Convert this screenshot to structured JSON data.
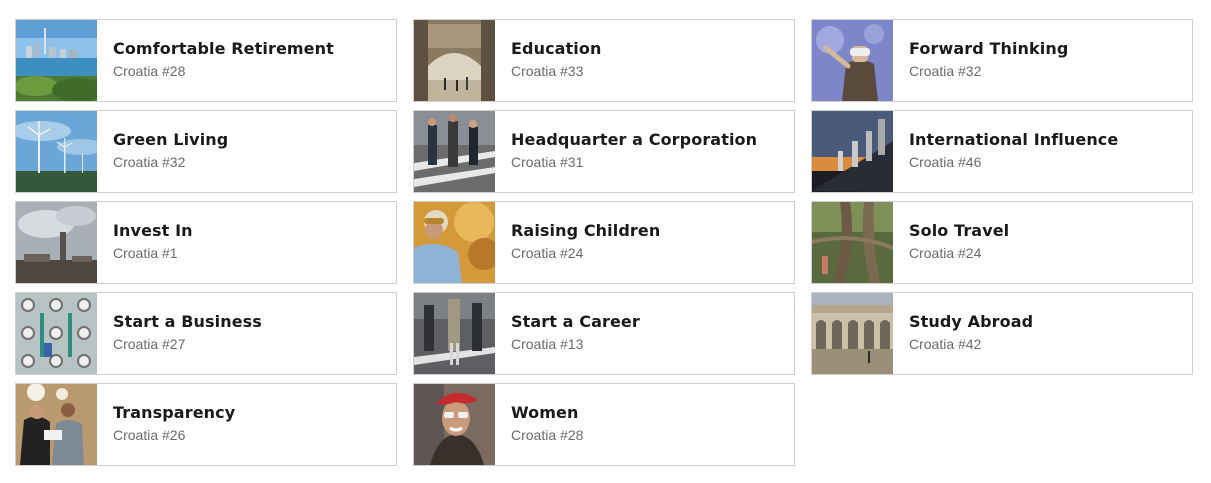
{
  "cards": [
    {
      "title": "Comfortable Retirement",
      "subtitle": "Croatia #28",
      "image": "city-skyline-harbor-image"
    },
    {
      "title": "Education",
      "subtitle": "Croatia #33",
      "image": "stone-arch-bridge-image"
    },
    {
      "title": "Forward Thinking",
      "subtitle": "Croatia #32",
      "image": "vr-headset-person-image"
    },
    {
      "title": "Green Living",
      "subtitle": "Croatia #32",
      "image": "wind-turbines-image"
    },
    {
      "title": "Headquarter a Corporation",
      "subtitle": "Croatia #31",
      "image": "crosswalk-commuters-image"
    },
    {
      "title": "International Influence",
      "subtitle": "Croatia #46",
      "image": "flags-on-building-image"
    },
    {
      "title": "Invest In",
      "subtitle": "Croatia #1",
      "image": "industrial-smokestack-image"
    },
    {
      "title": "Raising Children",
      "subtitle": "Croatia #24",
      "image": "child-autumn-leaves-image"
    },
    {
      "title": "Solo Travel",
      "subtitle": "Croatia #24",
      "image": "jungle-tree-roots-image"
    },
    {
      "title": "Start a Business",
      "subtitle": "Croatia #27",
      "image": "machinery-worker-image"
    },
    {
      "title": "Start a Career",
      "subtitle": "Croatia #13",
      "image": "street-walkers-image"
    },
    {
      "title": "Study Abroad",
      "subtitle": "Croatia #42",
      "image": "university-colonnade-image"
    },
    {
      "title": "Transparency",
      "subtitle": "Croatia #26",
      "image": "two-people-reading-image"
    },
    {
      "title": "Women",
      "subtitle": "Croatia #28",
      "image": "woman-red-beret-image"
    }
  ]
}
